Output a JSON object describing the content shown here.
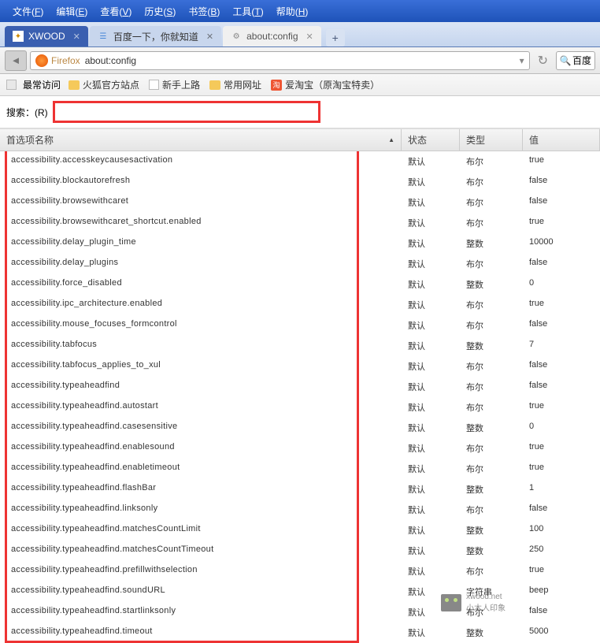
{
  "menubar": [
    "文件(F)",
    "编辑(E)",
    "查看(V)",
    "历史(S)",
    "书签(B)",
    "工具(T)",
    "帮助(H)"
  ],
  "tabs": [
    {
      "label": "XWOOD",
      "active": true
    },
    {
      "label": "百度一下，你就知道",
      "active": false
    },
    {
      "label": "about:config",
      "active": false
    }
  ],
  "urlbar": {
    "identity": "Firefox",
    "url": "about:config",
    "search_placeholder": "百度"
  },
  "bookmarks": {
    "most": "最常访问",
    "items": [
      {
        "icon": "folder",
        "label": "火狐官方站点"
      },
      {
        "icon": "page",
        "label": "新手上路"
      },
      {
        "icon": "folder",
        "label": "常用网址"
      },
      {
        "icon": "tao",
        "label": "爱淘宝（原淘宝特卖）"
      }
    ]
  },
  "search": {
    "label": "搜索：(R)",
    "value": ""
  },
  "columns": {
    "name": "首选项名称",
    "status": "状态",
    "type": "类型",
    "value": "值"
  },
  "prefs": [
    {
      "name": "accessibility.accesskeycausesactivation",
      "status": "默认",
      "type": "布尔",
      "value": "true"
    },
    {
      "name": "accessibility.blockautorefresh",
      "status": "默认",
      "type": "布尔",
      "value": "false"
    },
    {
      "name": "accessibility.browsewithcaret",
      "status": "默认",
      "type": "布尔",
      "value": "false"
    },
    {
      "name": "accessibility.browsewithcaret_shortcut.enabled",
      "status": "默认",
      "type": "布尔",
      "value": "true"
    },
    {
      "name": "accessibility.delay_plugin_time",
      "status": "默认",
      "type": "整数",
      "value": "10000"
    },
    {
      "name": "accessibility.delay_plugins",
      "status": "默认",
      "type": "布尔",
      "value": "false"
    },
    {
      "name": "accessibility.force_disabled",
      "status": "默认",
      "type": "整数",
      "value": "0"
    },
    {
      "name": "accessibility.ipc_architecture.enabled",
      "status": "默认",
      "type": "布尔",
      "value": "true"
    },
    {
      "name": "accessibility.mouse_focuses_formcontrol",
      "status": "默认",
      "type": "布尔",
      "value": "false"
    },
    {
      "name": "accessibility.tabfocus",
      "status": "默认",
      "type": "整数",
      "value": "7"
    },
    {
      "name": "accessibility.tabfocus_applies_to_xul",
      "status": "默认",
      "type": "布尔",
      "value": "false"
    },
    {
      "name": "accessibility.typeaheadfind",
      "status": "默认",
      "type": "布尔",
      "value": "false"
    },
    {
      "name": "accessibility.typeaheadfind.autostart",
      "status": "默认",
      "type": "布尔",
      "value": "true"
    },
    {
      "name": "accessibility.typeaheadfind.casesensitive",
      "status": "默认",
      "type": "整数",
      "value": "0"
    },
    {
      "name": "accessibility.typeaheadfind.enablesound",
      "status": "默认",
      "type": "布尔",
      "value": "true"
    },
    {
      "name": "accessibility.typeaheadfind.enabletimeout",
      "status": "默认",
      "type": "布尔",
      "value": "true"
    },
    {
      "name": "accessibility.typeaheadfind.flashBar",
      "status": "默认",
      "type": "整数",
      "value": "1"
    },
    {
      "name": "accessibility.typeaheadfind.linksonly",
      "status": "默认",
      "type": "布尔",
      "value": "false"
    },
    {
      "name": "accessibility.typeaheadfind.matchesCountLimit",
      "status": "默认",
      "type": "整数",
      "value": "100"
    },
    {
      "name": "accessibility.typeaheadfind.matchesCountTimeout",
      "status": "默认",
      "type": "整数",
      "value": "250"
    },
    {
      "name": "accessibility.typeaheadfind.prefillwithselection",
      "status": "默认",
      "type": "布尔",
      "value": "true"
    },
    {
      "name": "accessibility.typeaheadfind.soundURL",
      "status": "默认",
      "type": "字符串",
      "value": "beep"
    },
    {
      "name": "accessibility.typeaheadfind.startlinksonly",
      "status": "默认",
      "type": "布尔",
      "value": "false"
    },
    {
      "name": "accessibility.typeaheadfind.timeout",
      "status": "默认",
      "type": "整数",
      "value": "5000"
    }
  ],
  "watermark": {
    "site": "xwood.net",
    "tag": "小木人印象"
  }
}
